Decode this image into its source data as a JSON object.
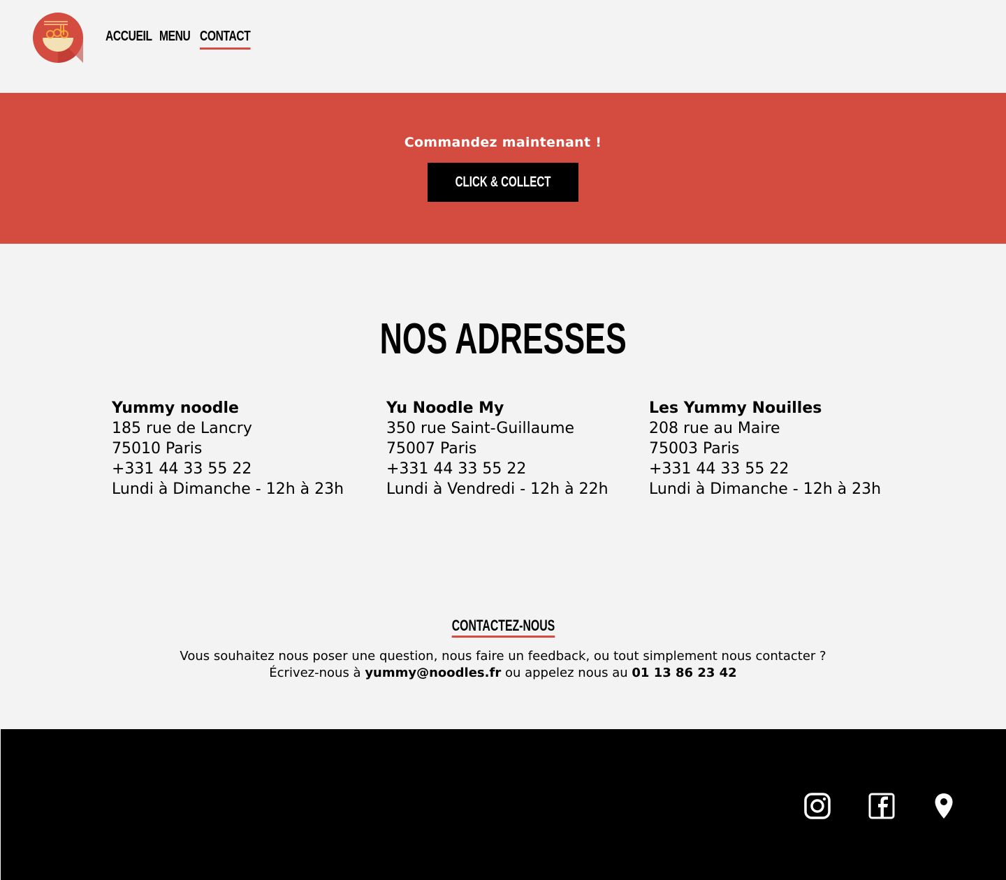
{
  "header": {
    "nav": [
      {
        "label": "ACCUEIL",
        "active": false
      },
      {
        "label": "MENU",
        "active": false
      },
      {
        "label": "CONTACT",
        "active": true
      }
    ]
  },
  "banner": {
    "text": "Commandez maintenant !",
    "button_label": "CLICK & COLLECT"
  },
  "addresses": {
    "title": "NOS ADRESSES",
    "items": [
      {
        "name": "Yummy noodle",
        "street": "185 rue de Lancry",
        "city": "75010 Paris",
        "phone": "+331 44 33 55 22",
        "hours": "Lundi à Dimanche - 12h à 23h"
      },
      {
        "name": "Yu Noodle My",
        "street": "350 rue Saint-Guillaume",
        "city": "75007 Paris",
        "phone": "+331 44 33 55 22",
        "hours": "Lundi à Vendredi - 12h à 22h"
      },
      {
        "name": "Les Yummy Nouilles",
        "street": "208 rue au Maire",
        "city": "75003 Paris",
        "phone": "+331 44 33 55 22",
        "hours": "Lundi à Dimanche - 12h à 23h"
      }
    ]
  },
  "contact": {
    "title": "CONTACTEZ-NOUS",
    "line1": "Vous souhaitez nous poser une question, nous faire un feedback, ou tout simplement nous contacter ?",
    "line2_prefix": "Écrivez-nous à",
    "email": "yummy@noodles.fr",
    "line2_middle": "ou appelez nous au",
    "phone": "01 13 86 23 42"
  },
  "footer": {
    "icons": [
      "instagram-icon",
      "facebook-icon",
      "map-pin-icon"
    ]
  },
  "colors": {
    "accent": "#d44b3f",
    "background": "#f3f3f3",
    "footer": "#000000"
  }
}
